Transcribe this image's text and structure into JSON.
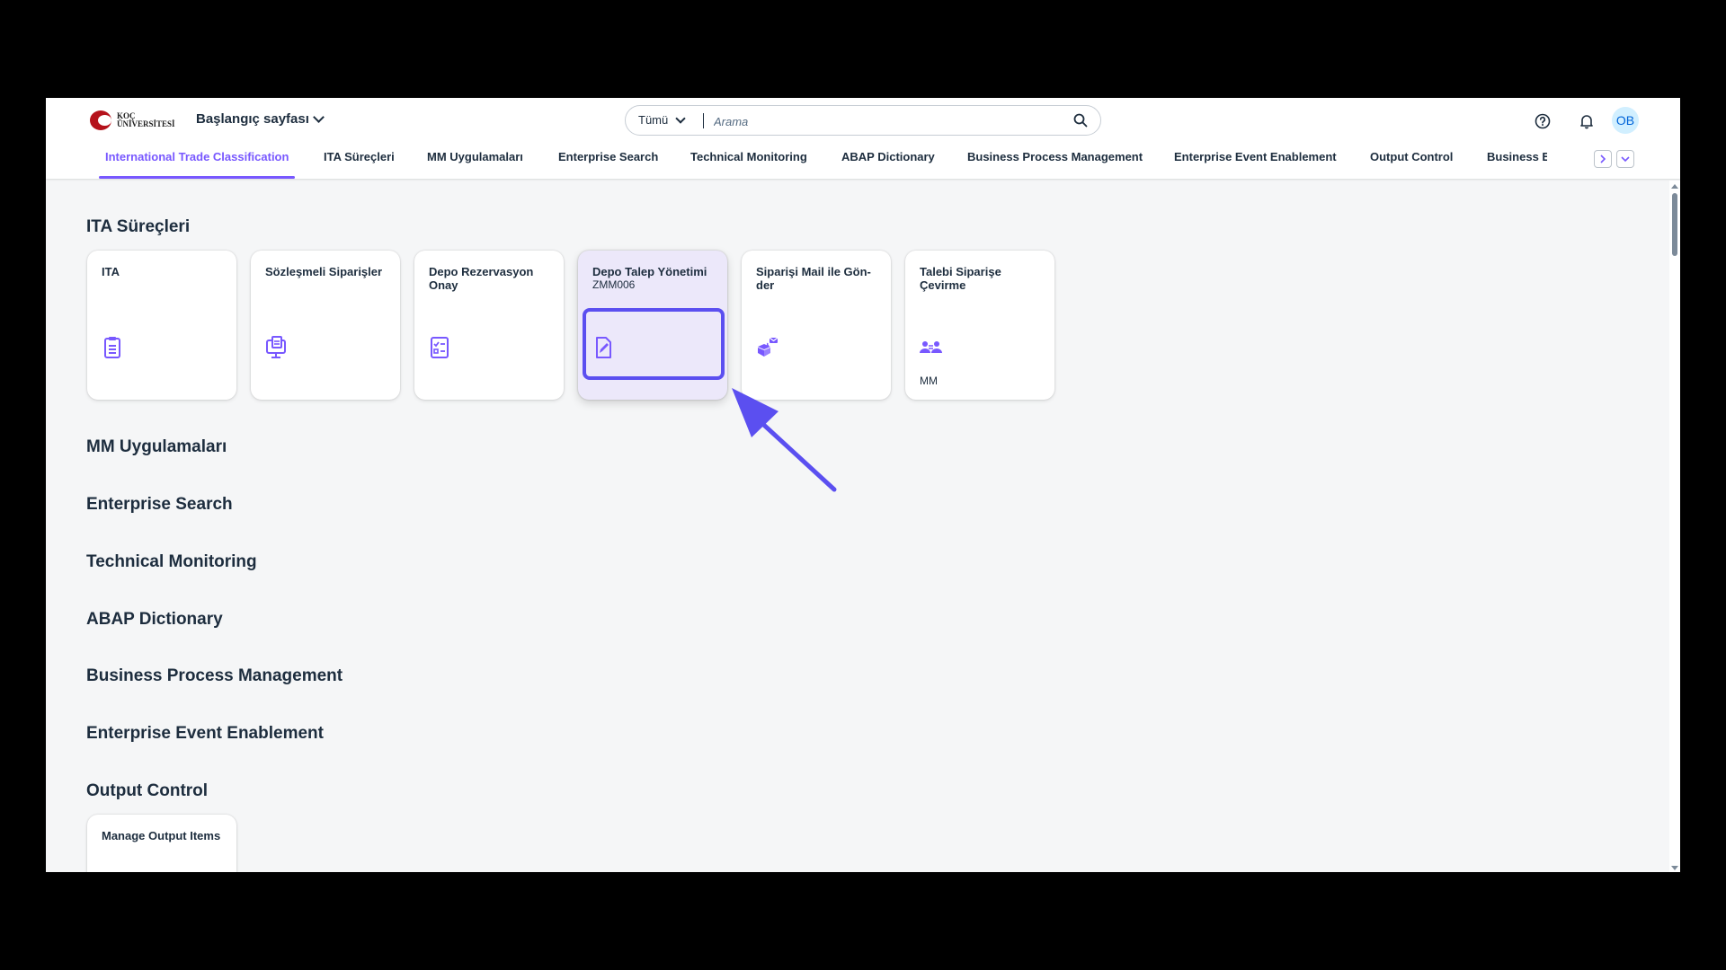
{
  "shell": {
    "logo_line1": "KOÇ",
    "logo_line2": "ÜNİVERSİTESİ",
    "home_label": "Başlangıç sayfası",
    "search_scope": "Tümü",
    "search_placeholder": "Arama",
    "avatar_initials": "OB"
  },
  "tabs": [
    {
      "label": "International Trade Classification",
      "active": true
    },
    {
      "label": "ITA Süreçleri"
    },
    {
      "label": "MM Uygulamaları"
    },
    {
      "label": "Enterprise Search"
    },
    {
      "label": "Technical Monitoring"
    },
    {
      "label": "ABAP Dictionary"
    },
    {
      "label": "Business Process Management"
    },
    {
      "label": "Enterprise Event Enablement"
    },
    {
      "label": "Output Control"
    },
    {
      "label": "Business Event Ha"
    }
  ],
  "sections": {
    "ita": "ITA Süreçleri",
    "mm": "MM Uygulamaları",
    "es": "Enterprise Search",
    "tm": "Technical Monitoring",
    "abap": "ABAP Dictionary",
    "bpm": "Business Process Management",
    "eee": "Enterprise Event Enablement",
    "oc": "Output Control"
  },
  "tiles": [
    {
      "title": "ITA",
      "icon": "clipboard-list-icon"
    },
    {
      "title": "Sözleşmeli Siparişler",
      "icon": "monitor-document-icon"
    },
    {
      "title": "Depo Rezervasyon Onay",
      "icon": "checklist-icon"
    },
    {
      "title": "Depo Talep Yönetimi",
      "subtitle": "ZMM006",
      "icon": "edit-document-icon"
    },
    {
      "title": "Siparişi Mail ile Gön-der",
      "icon": "box-mail-icon"
    },
    {
      "title": "Talebi Siparişe Çevirme",
      "icon": "users-transfer-icon",
      "footer": "MM"
    }
  ],
  "output_tile": {
    "title": "Manage Output Items"
  },
  "colors": {
    "accent": "#7858ff",
    "highlight": "#5b4ff0",
    "icon": "#7858ff"
  }
}
